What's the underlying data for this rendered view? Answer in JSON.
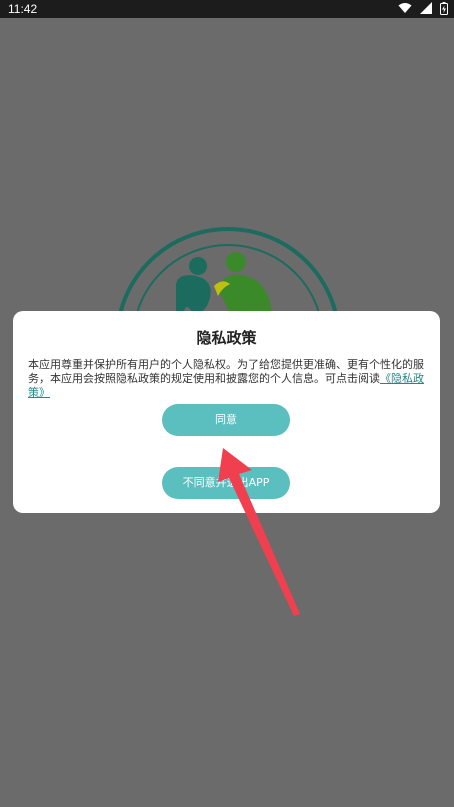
{
  "status_bar": {
    "time": "11:42"
  },
  "dialog": {
    "title": "隐私政策",
    "body_text": "本应用尊重并保护所有用户的个人隐私权。为了给您提供更准确、更有个性化的服务，本应用会按照隐私政策的规定使用和披露您的个人信息。可点击阅读",
    "policy_link": "《隐私政策》",
    "agree_label": "同意",
    "disagree_label": "不同意并退出APP"
  },
  "colors": {
    "overlay": "#6b6b6b",
    "button": "#5bbfbf",
    "link": "#1e8a8a",
    "logo_ring": "#1b6b5f",
    "annotation_arrow": "#f04050"
  }
}
